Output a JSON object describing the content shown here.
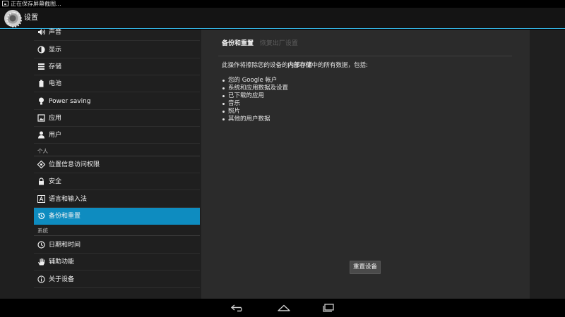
{
  "status_bar": {
    "ticker": "正在保存屏幕截图..."
  },
  "action_bar": {
    "title": "设置"
  },
  "sidebar": {
    "items_top": [
      {
        "label": "声音",
        "icon": "speaker-icon"
      },
      {
        "label": "显示",
        "icon": "brightness-icon"
      },
      {
        "label": "存储",
        "icon": "storage-icon"
      },
      {
        "label": "电池",
        "icon": "battery-icon"
      },
      {
        "label": "Power saving",
        "icon": "lightbulb-icon"
      },
      {
        "label": "应用",
        "icon": "apps-icon"
      },
      {
        "label": "用户",
        "icon": "user-icon"
      }
    ],
    "section_personal": "个人",
    "items_personal": [
      {
        "label": "位置信息访问权限",
        "icon": "location-icon"
      },
      {
        "label": "安全",
        "icon": "lock-icon"
      },
      {
        "label": "语言和输入法",
        "icon": "language-icon"
      },
      {
        "label": "备份和重置",
        "icon": "backup-icon",
        "selected": true
      }
    ],
    "section_system": "系统",
    "items_system": [
      {
        "label": "日期和时间",
        "icon": "clock-icon"
      },
      {
        "label": "辅助功能",
        "icon": "hand-icon"
      },
      {
        "label": "关于设备",
        "icon": "info-icon"
      }
    ]
  },
  "panel": {
    "breadcrumb_current": "备份和重置",
    "breadcrumb_sub": "恢复出厂设置",
    "desc_prefix": "此操作将擦除您的设备的",
    "desc_bold": "内部存储",
    "desc_suffix": "中的所有数据，包括:",
    "bullets": [
      "您的 Google 帐户",
      "系统和应用数据及设置",
      "已下载的应用",
      "音乐",
      "照片",
      "其他的用户数据"
    ],
    "reset_button": "重置设备"
  },
  "colors": {
    "accent": "#33b5e5",
    "selected": "#0e8cc0"
  }
}
